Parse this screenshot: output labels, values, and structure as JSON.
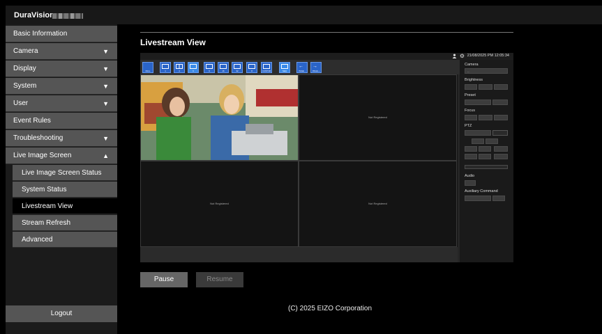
{
  "app": {
    "brand": "DuraVision"
  },
  "sidebar": {
    "items": [
      {
        "label": "Basic Information",
        "arrow": ""
      },
      {
        "label": "Camera",
        "arrow": "▼"
      },
      {
        "label": "Display",
        "arrow": "▼"
      },
      {
        "label": "System",
        "arrow": "▼"
      },
      {
        "label": "User",
        "arrow": "▼"
      },
      {
        "label": "Event Rules",
        "arrow": ""
      },
      {
        "label": "Troubleshooting",
        "arrow": "▼"
      },
      {
        "label": "Live Image Screen",
        "arrow": "▲"
      }
    ],
    "sub_items": [
      {
        "label": "Live Image Screen Status"
      },
      {
        "label": "System Status"
      },
      {
        "label": "Livestream View",
        "active": true
      },
      {
        "label": "Stream Refresh"
      },
      {
        "label": "Advanced"
      }
    ],
    "logout_label": "Logout"
  },
  "main": {
    "title": "Livestream View",
    "datetime": "21/08/2025 PM 12:05:34",
    "toolbar": {
      "buttons": [
        "FULL",
        "1",
        "4",
        "6",
        "9",
        "16",
        "32",
        "8",
        "CUSTOM",
        "SEQ",
        "PAGE -",
        "PAGE +"
      ]
    },
    "cells": [
      "",
      "Not Registered",
      "Not Registered",
      "Not Registered"
    ],
    "control_panel": {
      "camera_label": "Camera",
      "camera_value": "--",
      "brightness_label": "Brightness",
      "preset_label": "Preset",
      "focus_label": "Focus",
      "ptz_label": "PTZ",
      "audio_label": "Audio",
      "aux_label": "Auxiliary Command"
    },
    "pause_label": "Pause",
    "resume_label": "Resume"
  },
  "footer": {
    "copyright": "(C) 2025 EIZO Corporation"
  },
  "colors": {
    "accent": "#2a64c8",
    "sidebar_item": "#555555",
    "active_item": "#000000"
  }
}
